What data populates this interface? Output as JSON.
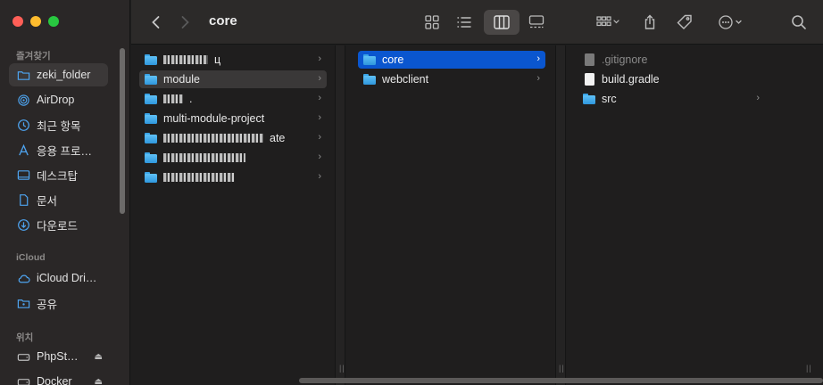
{
  "window": {
    "title": "core"
  },
  "sidebar": {
    "favorites_header": "즐겨찾기",
    "favorites": [
      {
        "label": "zeki_folder",
        "icon": "folder-icon",
        "active": true
      },
      {
        "label": "AirDrop",
        "icon": "airdrop-icon"
      },
      {
        "label": "최근 항목",
        "icon": "clock-icon"
      },
      {
        "label": "응용 프로…",
        "icon": "applications-icon"
      },
      {
        "label": "데스크탑",
        "icon": "desktop-icon"
      },
      {
        "label": "문서",
        "icon": "document-icon"
      },
      {
        "label": "다운로드",
        "icon": "download-icon"
      }
    ],
    "icloud_header": "iCloud",
    "icloud": [
      {
        "label": "iCloud Dri…",
        "icon": "cloud-icon"
      },
      {
        "label": "공유",
        "icon": "shared-folder-icon"
      }
    ],
    "locations_header": "위치",
    "locations": [
      {
        "label": "PhpSt…",
        "icon": "disk-icon"
      },
      {
        "label": "Docker",
        "icon": "disk-icon"
      }
    ]
  },
  "columns": {
    "col1": [
      {
        "label": "",
        "redacted": true,
        "suffix": "ц"
      },
      {
        "label": "module",
        "hover": true
      },
      {
        "label": "",
        "redacted": true,
        "suffix": "."
      },
      {
        "label": "multi-module-project"
      },
      {
        "label": "",
        "redacted": true,
        "suffix": "ate"
      },
      {
        "label": "",
        "redacted": true,
        "suffix": ""
      },
      {
        "label": "",
        "redacted": true,
        "suffix": ""
      }
    ],
    "col2": [
      {
        "label": "core",
        "selected": true
      },
      {
        "label": "webclient"
      }
    ],
    "col3": [
      {
        "label": ".gitignore",
        "type": "file",
        "dim": true
      },
      {
        "label": "build.gradle",
        "type": "file"
      },
      {
        "label": "src",
        "type": "folder"
      }
    ]
  },
  "colors": {
    "selection": "#0a56cf",
    "folder": "#4fb3f0",
    "close": "#ff5f57",
    "minimize": "#febc2e",
    "zoom": "#28c840"
  }
}
